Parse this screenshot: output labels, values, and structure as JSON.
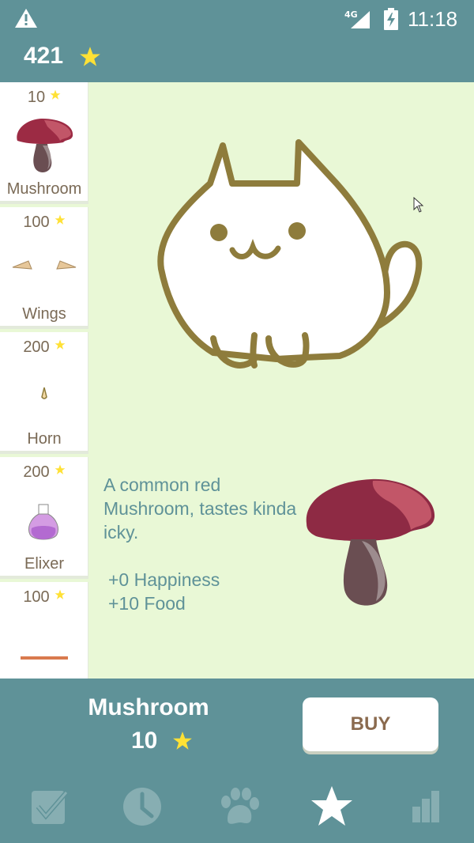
{
  "status_bar": {
    "network": "4G",
    "time": "11:18"
  },
  "header": {
    "coins": "421",
    "coin_icon": "star-icon"
  },
  "colors": {
    "primary": "#5f9298",
    "background": "#e9f8d6",
    "star": "#ffe135",
    "label": "#7a6a56",
    "accent_text": "#5f9298",
    "cat_outline": "#8e7c3c"
  },
  "shop": {
    "items": [
      {
        "price": "10",
        "name": "Mushroom",
        "icon": "mushroom-icon"
      },
      {
        "price": "100",
        "name": "Wings",
        "icon": "wings-icon"
      },
      {
        "price": "200",
        "name": "Horn",
        "icon": "horn-icon"
      },
      {
        "price": "200",
        "name": "Elixer",
        "icon": "potion-icon"
      },
      {
        "price": "100",
        "name": "",
        "icon": "stick-icon"
      }
    ]
  },
  "detail": {
    "description": "A common red Mushroom, tastes kinda icky.",
    "happiness": "+0 Happiness",
    "food": "+10 Food"
  },
  "purchase": {
    "item_name": "Mushroom",
    "price": "10",
    "buy_label": "BUY"
  },
  "nav": {
    "items": [
      {
        "name": "tasks",
        "icon": "checkbox-icon",
        "active": false
      },
      {
        "name": "history",
        "icon": "clock-icon",
        "active": false
      },
      {
        "name": "pet",
        "icon": "paw-icon",
        "active": false
      },
      {
        "name": "shop",
        "icon": "star-icon",
        "active": true
      },
      {
        "name": "stats",
        "icon": "bar-chart-icon",
        "active": false
      }
    ]
  }
}
